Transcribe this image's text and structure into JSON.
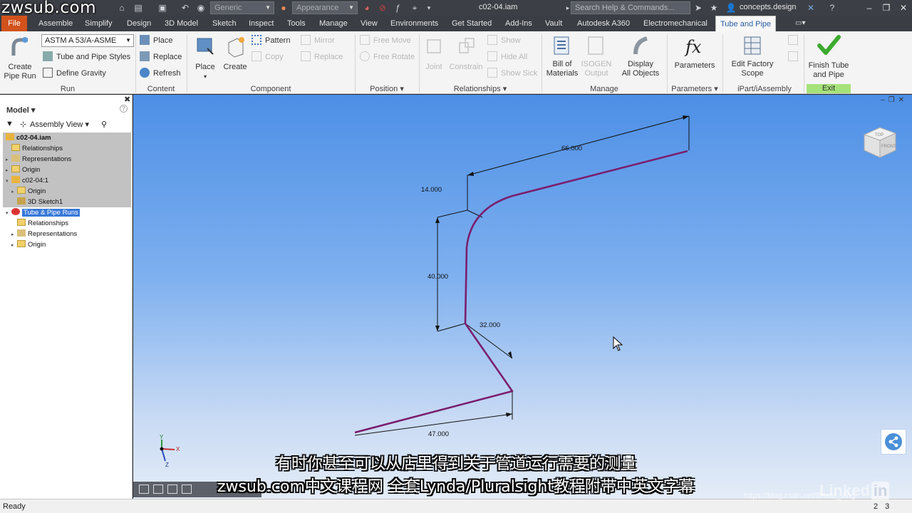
{
  "overlay": {
    "watermark": "zwsub.com",
    "subtitle_line1": "有时你甚至可以从店里得到关于管道运行需要的测量",
    "subtitle_line2": "zwsub.com中文课程网 全套Lynda/Pluralsight教程附带中英文字幕",
    "linkedin_text": "Linked",
    "linkedin_in": "in",
    "csdn_text": "https://blog.csdn.net/Bruce_Jing"
  },
  "titlebar": {
    "material_combo": "Generic",
    "appearance_combo": "Appearance",
    "document": "c02-04.iam",
    "search_placeholder": "Search Help & Commands...",
    "user": "concepts.design",
    "fx_glyph": "ƒ",
    "minimize": "–",
    "restore": "❐",
    "close": "✕"
  },
  "menu": {
    "tabs": [
      "File",
      "Assemble",
      "Simplify",
      "Design",
      "3D Model",
      "Sketch",
      "Inspect",
      "Tools",
      "Manage",
      "View",
      "Environments",
      "Get Started",
      "Add-Ins",
      "Vault",
      "Autodesk A360",
      "Electromechanical",
      "Tube and Pipe"
    ]
  },
  "ribbon": {
    "run": {
      "create_pipe_run_1": "Create",
      "create_pipe_run_2": "Pipe Run",
      "style_combo": "ASTM A 53/A-ASME",
      "tube_pipe_styles": "Tube and Pipe Styles",
      "define_gravity": "Define Gravity",
      "label": "Run"
    },
    "content": {
      "place": "Place",
      "replace": "Replace",
      "refresh": "Refresh",
      "label": "Content"
    },
    "component": {
      "place": "Place",
      "create": "Create",
      "pattern": "Pattern",
      "copy": "Copy",
      "mirror": "Mirror",
      "replace": "Replace",
      "label": "Component"
    },
    "position": {
      "free_move": "Free Move",
      "free_rotate": "Free Rotate",
      "label": "Position"
    },
    "relationships": {
      "joint": "Joint",
      "constrain": "Constrain",
      "show": "Show",
      "hide_all": "Hide All",
      "show_sick": "Show Sick",
      "label": "Relationships"
    },
    "manage": {
      "bom_1": "Bill of",
      "bom_2": "Materials",
      "isogen_1": "ISOGEN",
      "isogen_2": "Output",
      "display_1": "Display",
      "display_2": "All Objects",
      "label": "Manage"
    },
    "parameters": {
      "parameters": "Parameters",
      "label": "Parameters"
    },
    "ipart": {
      "edit_factory_1": "Edit Factory",
      "edit_factory_2": "Scope",
      "label": "iPart/iAssembly"
    },
    "exit": {
      "finish_1": "Finish Tube",
      "finish_2": "and Pipe",
      "label": "Exit"
    }
  },
  "browser": {
    "title": "Model",
    "view": "Assembly View",
    "nodes": [
      "c02-04.iam",
      "Relationships",
      "Representations",
      "Origin",
      "c02-04:1",
      "Origin",
      "3D Sketch1",
      "Tube & Pipe Runs",
      "Relationships",
      "Representations",
      "Origin"
    ]
  },
  "viewport": {
    "dimensions": [
      "66.000",
      "14.000",
      "40.000",
      "32.000",
      "47.000"
    ],
    "viewcube_top": "TOP",
    "viewcube_front": "FRONT",
    "axis_x": "X",
    "axis_y": "Y",
    "axis_z": "Z"
  },
  "status": {
    "text": "Ready",
    "num1": "2",
    "num2": "3"
  },
  "colors": {
    "pipe": "#7a1f6e",
    "file_tab": "#d2521c",
    "exit_green": "#a6e27a"
  }
}
